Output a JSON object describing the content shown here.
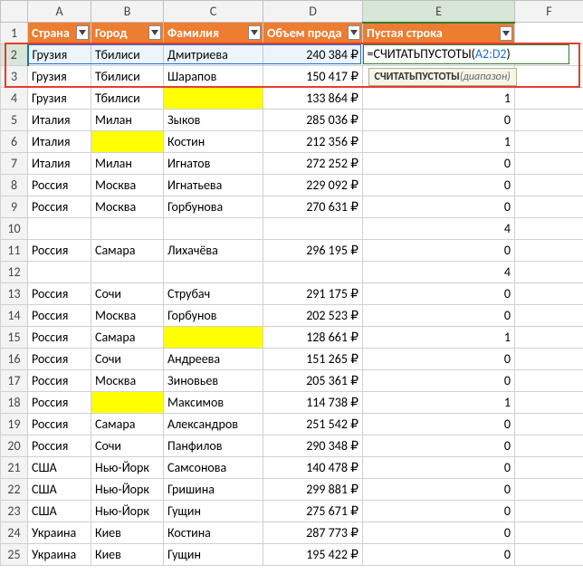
{
  "columns": [
    "A",
    "B",
    "C",
    "D",
    "E",
    "F"
  ],
  "active_column": "E",
  "active_row": 2,
  "headers": {
    "A": "Страна",
    "B": "Город",
    "C": "Фамилия",
    "D": "Объем прода",
    "E": "Пустая строка",
    "F": ""
  },
  "formula": {
    "prefix": "=СЧИТАТЬПУ",
    "rest": "СТОТЫ(",
    "ref": "A2:D2",
    "close": ")"
  },
  "tooltip": {
    "fn": "СЧИТАТЬПУСТОТЫ",
    "arg": "(диапазон)"
  },
  "red_box_note": "A2:D3 highlighted",
  "rows": [
    {
      "n": 2,
      "A": "Грузия",
      "B": "Тбилиси",
      "C": "Дмитриева",
      "D": "240 384 ₽",
      "E": "",
      "hlC": false,
      "hlB": false
    },
    {
      "n": 3,
      "A": "Грузия",
      "B": "Тбилиси",
      "C": "Шарапов",
      "D": "150 417 ₽",
      "E": ""
    },
    {
      "n": 4,
      "A": "Грузия",
      "B": "Тбилиси",
      "C": "",
      "D": "133 864 ₽",
      "E": "1",
      "hlC": true
    },
    {
      "n": 5,
      "A": "Италия",
      "B": "Милан",
      "C": "Зыков",
      "D": "285 036 ₽",
      "E": "0"
    },
    {
      "n": 6,
      "A": "Италия",
      "B": "",
      "C": "Костин",
      "D": "212 356 ₽",
      "E": "1",
      "hlB": true
    },
    {
      "n": 7,
      "A": "Италия",
      "B": "Милан",
      "C": "Игнатов",
      "D": "272 252 ₽",
      "E": "0"
    },
    {
      "n": 8,
      "A": "Россия",
      "B": "Москва",
      "C": "Игнатьева",
      "D": "229 092 ₽",
      "E": "0"
    },
    {
      "n": 9,
      "A": "Россия",
      "B": "Москва",
      "C": "Горбунова",
      "D": "270 631 ₽",
      "E": "0"
    },
    {
      "n": 10,
      "A": "",
      "B": "",
      "C": "",
      "D": "",
      "E": "4"
    },
    {
      "n": 11,
      "A": "Россия",
      "B": "Самара",
      "C": "Лихачёва",
      "D": "296 195 ₽",
      "E": "0"
    },
    {
      "n": 12,
      "A": "",
      "B": "",
      "C": "",
      "D": "",
      "E": "4"
    },
    {
      "n": 13,
      "A": "Россия",
      "B": "Сочи",
      "C": "Струбач",
      "D": "291 175 ₽",
      "E": "0"
    },
    {
      "n": 14,
      "A": "Россия",
      "B": "Москва",
      "C": "Горбунов",
      "D": "202 523 ₽",
      "E": "0"
    },
    {
      "n": 15,
      "A": "Россия",
      "B": "Самара",
      "C": "",
      "D": "128 661 ₽",
      "E": "1",
      "hlC": true
    },
    {
      "n": 16,
      "A": "Россия",
      "B": "Сочи",
      "C": "Андреева",
      "D": "151 265 ₽",
      "E": "0"
    },
    {
      "n": 17,
      "A": "Россия",
      "B": "Москва",
      "C": "Зиновьев",
      "D": "205 361 ₽",
      "E": "0"
    },
    {
      "n": 18,
      "A": "Россия",
      "B": "",
      "C": "Максимов",
      "D": "114 738 ₽",
      "E": "1",
      "hlB": true
    },
    {
      "n": 19,
      "A": "Россия",
      "B": "Самара",
      "C": "Александров",
      "D": "251 542 ₽",
      "E": "0"
    },
    {
      "n": 20,
      "A": "Россия",
      "B": "Сочи",
      "C": "Панфилов",
      "D": "290 348 ₽",
      "E": "0"
    },
    {
      "n": 21,
      "A": "США",
      "B": "Нью-Йорк",
      "C": "Самсонова",
      "D": "140 478 ₽",
      "E": "0"
    },
    {
      "n": 22,
      "A": "США",
      "B": "Нью-Йорк",
      "C": "Гришина",
      "D": "299 881 ₽",
      "E": "0"
    },
    {
      "n": 23,
      "A": "США",
      "B": "Нью-Йорк",
      "C": "Гущин",
      "D": "275 671 ₽",
      "E": "0"
    },
    {
      "n": 24,
      "A": "Украина",
      "B": "Киев",
      "C": "Костина",
      "D": "287 773 ₽",
      "E": "0"
    },
    {
      "n": 25,
      "A": "Украина",
      "B": "Киев",
      "C": "Гущин",
      "D": "195 422 ₽",
      "E": "0"
    }
  ]
}
